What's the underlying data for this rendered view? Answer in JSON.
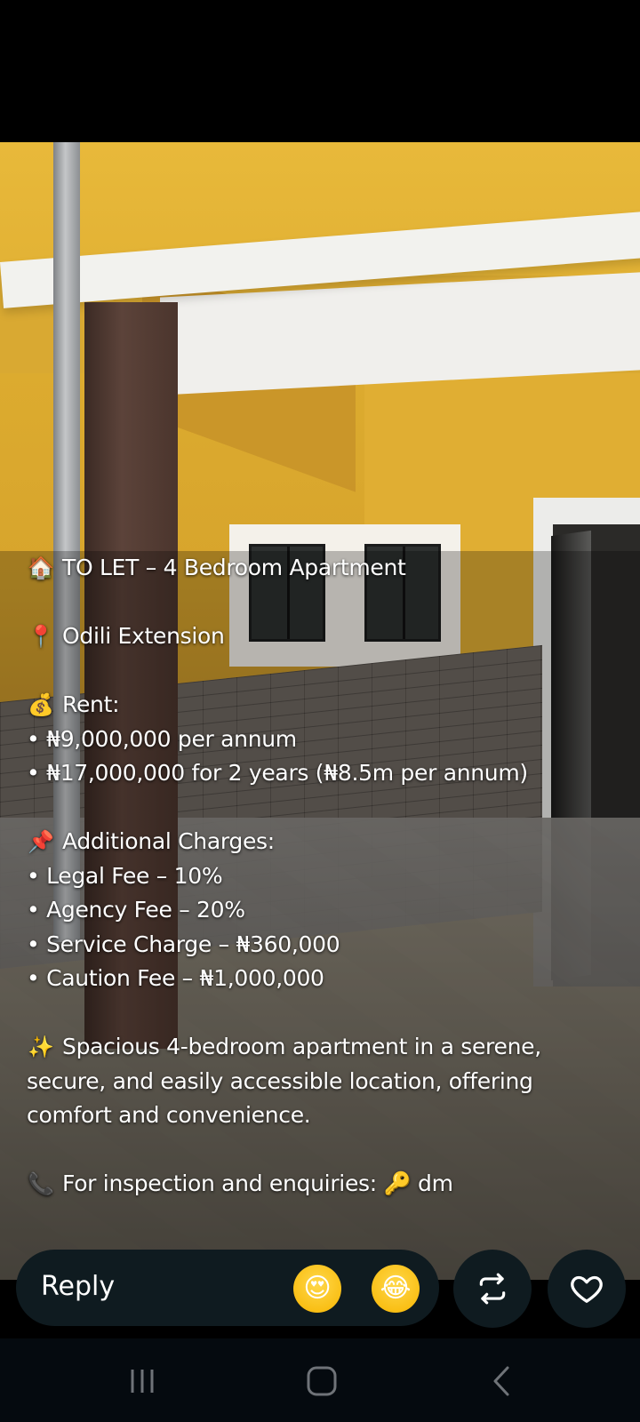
{
  "post": {
    "caption": [
      {
        "icon": "house-icon",
        "emoji": "🏠",
        "text": "TO LET – 4 Bedroom Apartment"
      },
      {
        "blank": true
      },
      {
        "icon": "pin-icon",
        "emoji": "📍",
        "text": "Odili Extension"
      },
      {
        "blank": true
      },
      {
        "icon": "money-bag-icon",
        "emoji": "💰",
        "text": "Rent:"
      },
      {
        "text": "• ₦9,000,000 per annum"
      },
      {
        "text": "• ₦17,000,000 for 2 years (₦8.5m per annum)"
      },
      {
        "blank": true
      },
      {
        "icon": "pushpin-icon",
        "emoji": "📌",
        "text": "Additional Charges:"
      },
      {
        "text": "• Legal Fee – 10%"
      },
      {
        "text": "• Agency Fee – 20%"
      },
      {
        "text": "• Service Charge – ₦360,000"
      },
      {
        "text": "• Caution Fee – ₦1,000,000"
      },
      {
        "blank": true
      },
      {
        "icon": "sparkles-icon",
        "emoji": "✨",
        "text": "Spacious 4-bedroom apartment in a serene, secure, and easily accessible location, offering comfort and convenience.",
        "wrap": true
      },
      {
        "blank": true
      },
      {
        "icon": "phone-icon",
        "emoji": "📞",
        "text": "For inspection and enquiries: 🔑 dm"
      }
    ]
  },
  "reply_bar": {
    "placeholder": "Reply",
    "quick_reactions": [
      {
        "name": "heart-eyes-emoji",
        "emoji": "😍"
      },
      {
        "name": "tears-of-joy-emoji",
        "emoji": "😂"
      }
    ],
    "repost_icon": "repost-icon",
    "like_icon": "heart-icon"
  },
  "nav_bar": {
    "recents_icon": "recents-icon",
    "home_icon": "home-icon",
    "back_icon": "back-icon"
  }
}
